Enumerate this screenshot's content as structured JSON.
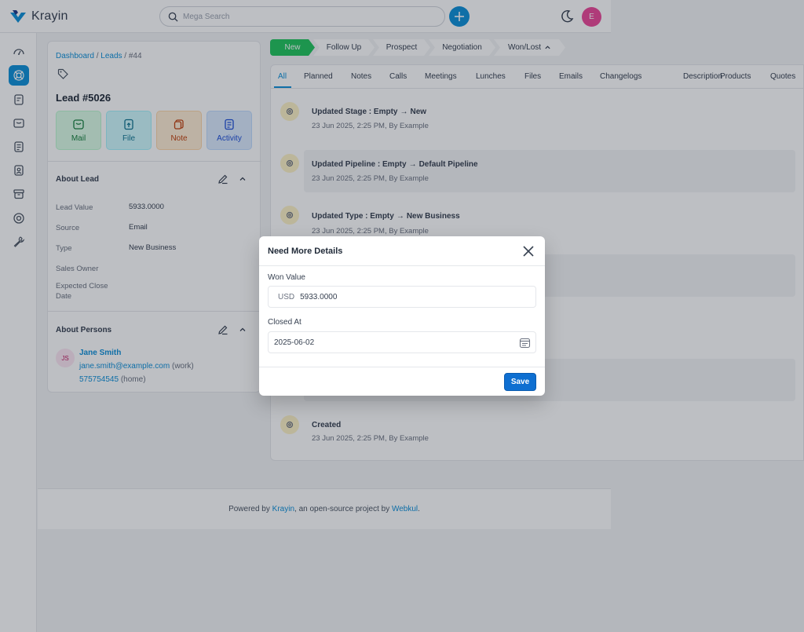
{
  "header": {
    "app_name": "Krayin",
    "search_placeholder": "Mega Search",
    "user_initial": "E"
  },
  "breadcrumb": {
    "dashboard": "Dashboard",
    "leads": "Leads",
    "current": "#44"
  },
  "lead": {
    "title": "Lead #5026",
    "actions": {
      "mail": "Mail",
      "file": "File",
      "note": "Note",
      "activity": "Activity"
    },
    "about_heading": "About Lead",
    "attributes": [
      {
        "label": "Lead Value",
        "value": "5933.0000"
      },
      {
        "label": "Source",
        "value": "Email"
      },
      {
        "label": "Type",
        "value": "New Business"
      },
      {
        "label": "Sales Owner",
        "value": ""
      },
      {
        "label": "Expected Close Date",
        "value": ""
      }
    ],
    "persons_heading": "About Persons",
    "person": {
      "initials": "JS",
      "name": "Jane Smith",
      "email": "jane.smith@example.com",
      "email_type": "(work)",
      "phone": "575754545",
      "phone_type": "(home)"
    }
  },
  "stages": [
    "New",
    "Follow Up",
    "Prospect",
    "Negotiation",
    "Won/Lost"
  ],
  "tabs": [
    "All",
    "Planned",
    "Notes",
    "Calls",
    "Meetings",
    "Lunches",
    "Files",
    "Emails",
    "Changelogs",
    "Description",
    "Products",
    "Quotes"
  ],
  "activities": [
    {
      "label": "Updated Stage : Empty",
      "to": "New",
      "sub": "23 Jun 2025, 2:25 PM, By Example"
    },
    {
      "label": "Updated Pipeline : Empty",
      "to": "Default Pipeline",
      "sub": "23 Jun 2025, 2:25 PM, By Example"
    },
    {
      "label": "Updated Type : Empty",
      "to": "New Business",
      "sub": "23 Jun 2025, 2:25 PM, By Example"
    },
    {
      "label": "Created",
      "to": "",
      "sub": "23 Jun 2025, 2:25 PM, By Example"
    }
  ],
  "footer": {
    "prefix": "Powered by ",
    "brand": "Krayin",
    "middle": ", an open-source project by ",
    "company": "Webkul",
    "suffix": "."
  },
  "modal": {
    "title": "Need More Details",
    "won_value_label": "Won Value",
    "currency": "USD",
    "won_value": "5933.0000",
    "closed_at_label": "Closed At",
    "closed_at": "2025-06-02",
    "save_label": "Save"
  },
  "colors": {
    "accent": "#0e90d9",
    "stage_active": "#22c55e",
    "save_button": "#0e6fd1"
  }
}
